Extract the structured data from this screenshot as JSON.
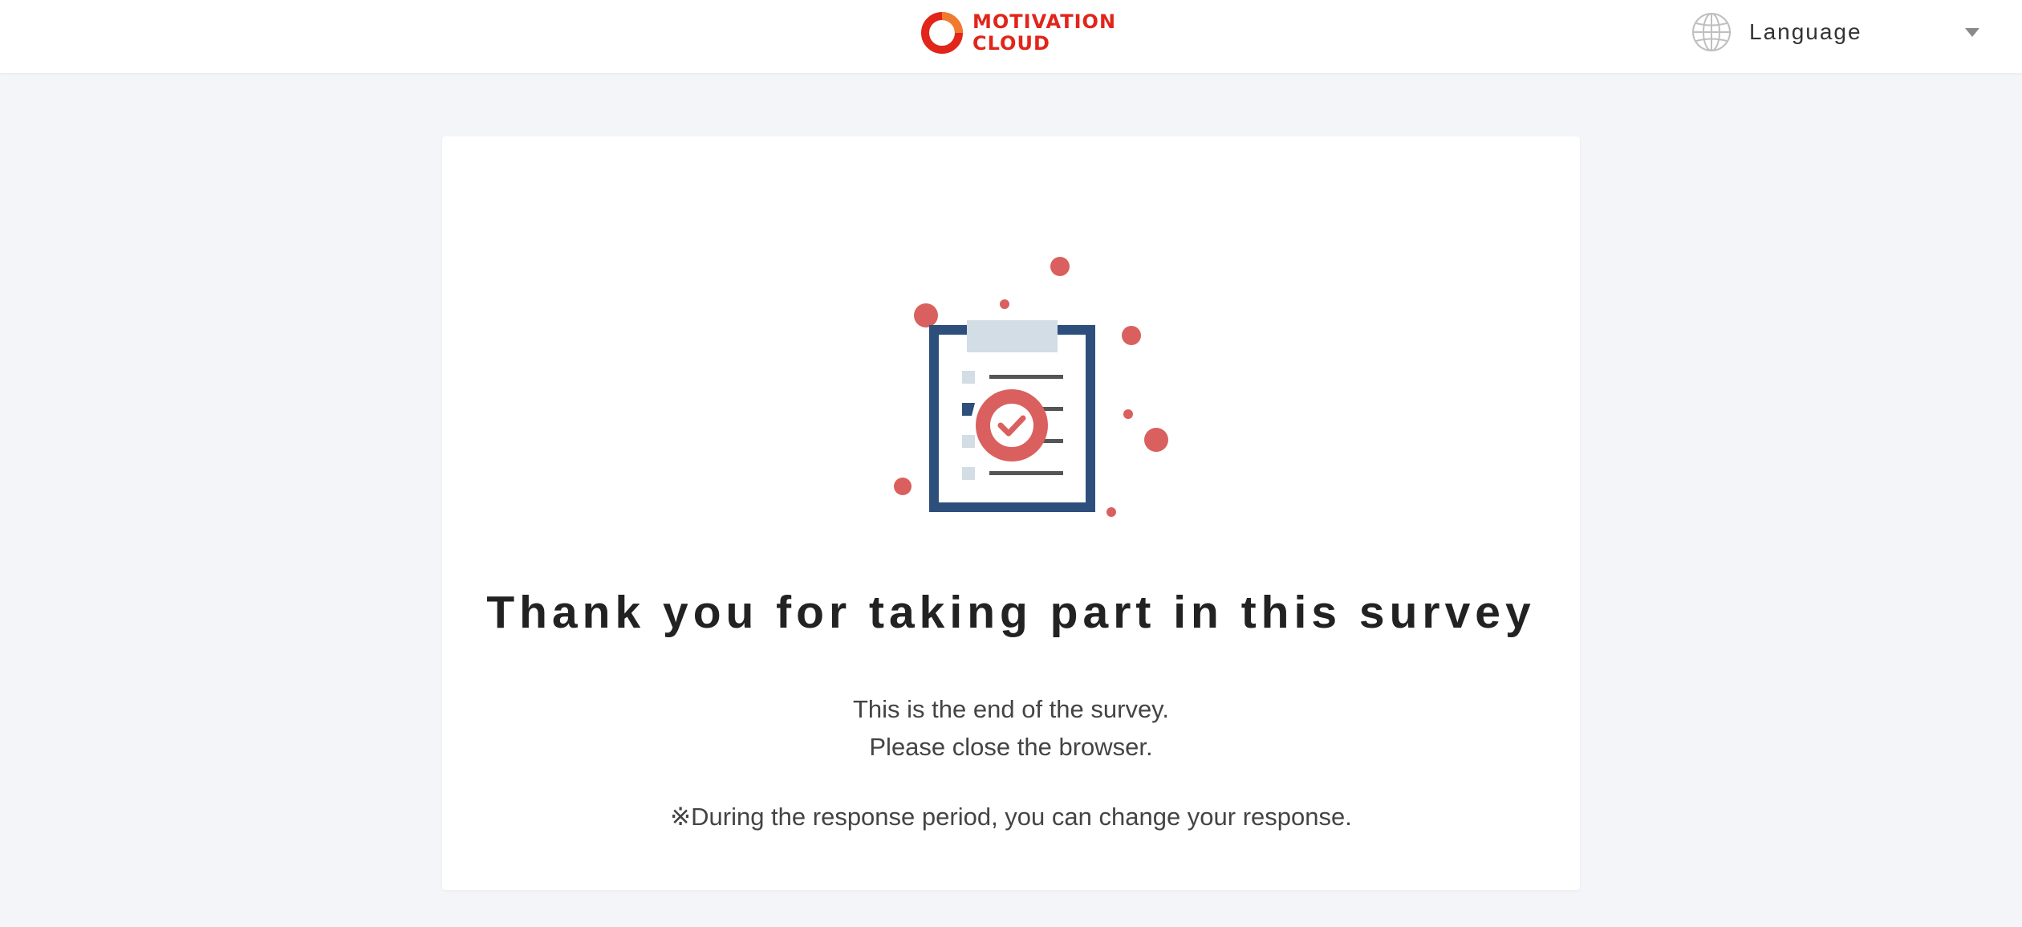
{
  "header": {
    "logo": {
      "line1": "MOTIVATION",
      "line2": "CLOUD",
      "brand_color": "#e1251b"
    },
    "language": {
      "label": "Language",
      "icon": "globe-icon",
      "dropdown_icon": "caret-down-icon"
    }
  },
  "main": {
    "illustration_icon": "clipboard-check-icon",
    "title": "Thank you for taking part in this survey",
    "message_line1": "This is the end of the survey.",
    "message_line2": "Please close the browser.",
    "note": "※During the response period, you can change your response."
  },
  "colors": {
    "accent": "#d9605e",
    "navy": "#2e4f7c",
    "light_blue": "#d2dde6",
    "background": "#f4f5f8"
  }
}
